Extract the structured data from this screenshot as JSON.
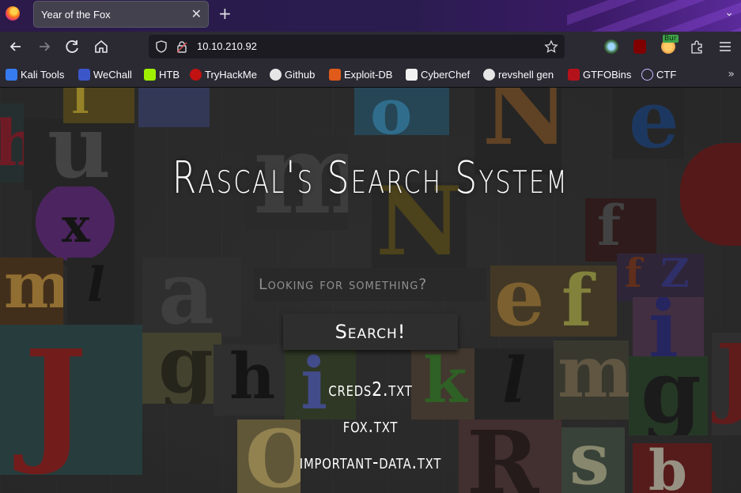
{
  "browser": {
    "tab_title": "Year of the Fox",
    "tab_close": "✕",
    "new_tab": "+",
    "tab_list": "⌄",
    "url": "10.10.210.92",
    "burp_badge": "Bur",
    "icons": {
      "back": "back-arrow-icon",
      "forward": "forward-arrow-icon",
      "reload": "reload-icon",
      "home": "home-icon",
      "shield": "tracking-protection-shield-icon",
      "lock": "insecure-lock-icon",
      "star": "bookmark-star-icon",
      "menu": "hamburger-menu-icon"
    }
  },
  "bookmarks": [
    {
      "label": "Kali Tools",
      "icon": "kali-dragon-icon",
      "color": "#367bf0"
    },
    {
      "label": "WeChall",
      "icon": "wechall-icon",
      "color": "#3a56c9"
    },
    {
      "label": "HTB",
      "icon": "hackthebox-cube-icon",
      "color": "#9fef00"
    },
    {
      "label": "TryHackMe",
      "icon": "tryhackme-cloud-icon",
      "color": "#c11111"
    },
    {
      "label": "Github",
      "icon": "github-octocat-icon",
      "color": "#e6e6e6"
    },
    {
      "label": "Exploit-DB",
      "icon": "exploit-db-bug-icon",
      "color": "#e05a1a"
    },
    {
      "label": "CyberChef",
      "icon": "cyberchef-hat-icon",
      "color": "#f2f2f2"
    },
    {
      "label": "revshell gen",
      "icon": "skull-icon",
      "color": "#e6e6e6"
    },
    {
      "label": "GTFOBins",
      "icon": "gtfobins-icon",
      "color": "#b4121b"
    },
    {
      "label": "CTF",
      "icon": "globe-icon",
      "color": "#c9b8ff"
    }
  ],
  "page": {
    "title": "Rascal's Search System",
    "search_placeholder": "Looking for something?",
    "search_button": "Search!",
    "results": [
      "creds2.txt",
      "fox.txt",
      "important-data.txt"
    ]
  },
  "colors": {
    "tab_bar": "#2b1a4a",
    "toolbar": "#2b2a33",
    "page_bg": "#3a3a3a",
    "input_bg": "#292929",
    "button_bg": "#2e2e2e"
  }
}
